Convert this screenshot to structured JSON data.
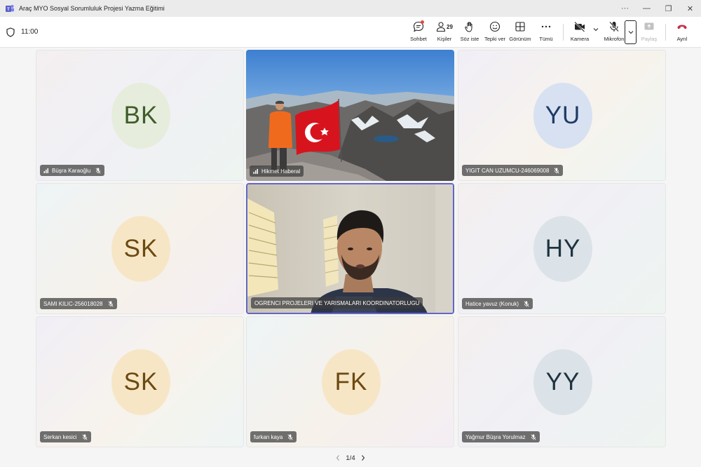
{
  "window": {
    "title": "Araç MYO Sosyal Sorumluluk Projesi Yazma Eğitimi",
    "controls": [
      "···",
      "—",
      "❐",
      "✕"
    ]
  },
  "meeting": {
    "time": "11:00"
  },
  "toolbar": {
    "chat": "Sohbet",
    "people": "Kişiler",
    "people_count": "29",
    "raise_hand": "Söz iste",
    "react": "Tepki ver",
    "view": "Görünüm",
    "more": "Tümü",
    "camera": "Kamera",
    "mic": "Mikrofon",
    "share": "Paylaş",
    "leave": "Ayrıl"
  },
  "participants": [
    {
      "initials": "BK",
      "name": "Büşra Karaoğlu",
      "avatar_bg": "#e6eddc",
      "avatar_fg": "#3f5c2a",
      "signal": true
    },
    {
      "initials": "",
      "name": "Hikmet Haberal",
      "video": "mountain-flag",
      "signal": true
    },
    {
      "initials": "YU",
      "name": "YIGIT CAN UZUMCU-246069008",
      "avatar_bg": "#d7e1f1",
      "avatar_fg": "#1f3a66",
      "signal": false
    },
    {
      "initials": "SK",
      "name": "SAMI KILIC-256018028",
      "avatar_bg": "#f7e6c6",
      "avatar_fg": "#6b4a12",
      "signal": false
    },
    {
      "initials": "",
      "name": "OGRENCI PROJELERI VE YARISMALARI KOORDINATORLUGU",
      "video": "room-camera",
      "signal": false
    },
    {
      "initials": "HY",
      "name": "Hatice yavuz (Konuk)",
      "avatar_bg": "#dbe3e8",
      "avatar_fg": "#1f3340",
      "signal": false
    },
    {
      "initials": "SK",
      "name": "Serkan kesici",
      "avatar_bg": "#f7e6c6",
      "avatar_fg": "#6b4a12",
      "signal": false
    },
    {
      "initials": "FK",
      "name": "furkan kaya",
      "avatar_bg": "#f7e6c6",
      "avatar_fg": "#6b4a12",
      "signal": false
    },
    {
      "initials": "YY",
      "name": "Yağmur Büşra Yorulmaz",
      "avatar_bg": "#dbe3e8",
      "avatar_fg": "#1f3340",
      "signal": false
    }
  ],
  "pager": {
    "label": "1/4"
  },
  "colors": {
    "accent": "#6366c7",
    "leave": "#c4314b"
  }
}
